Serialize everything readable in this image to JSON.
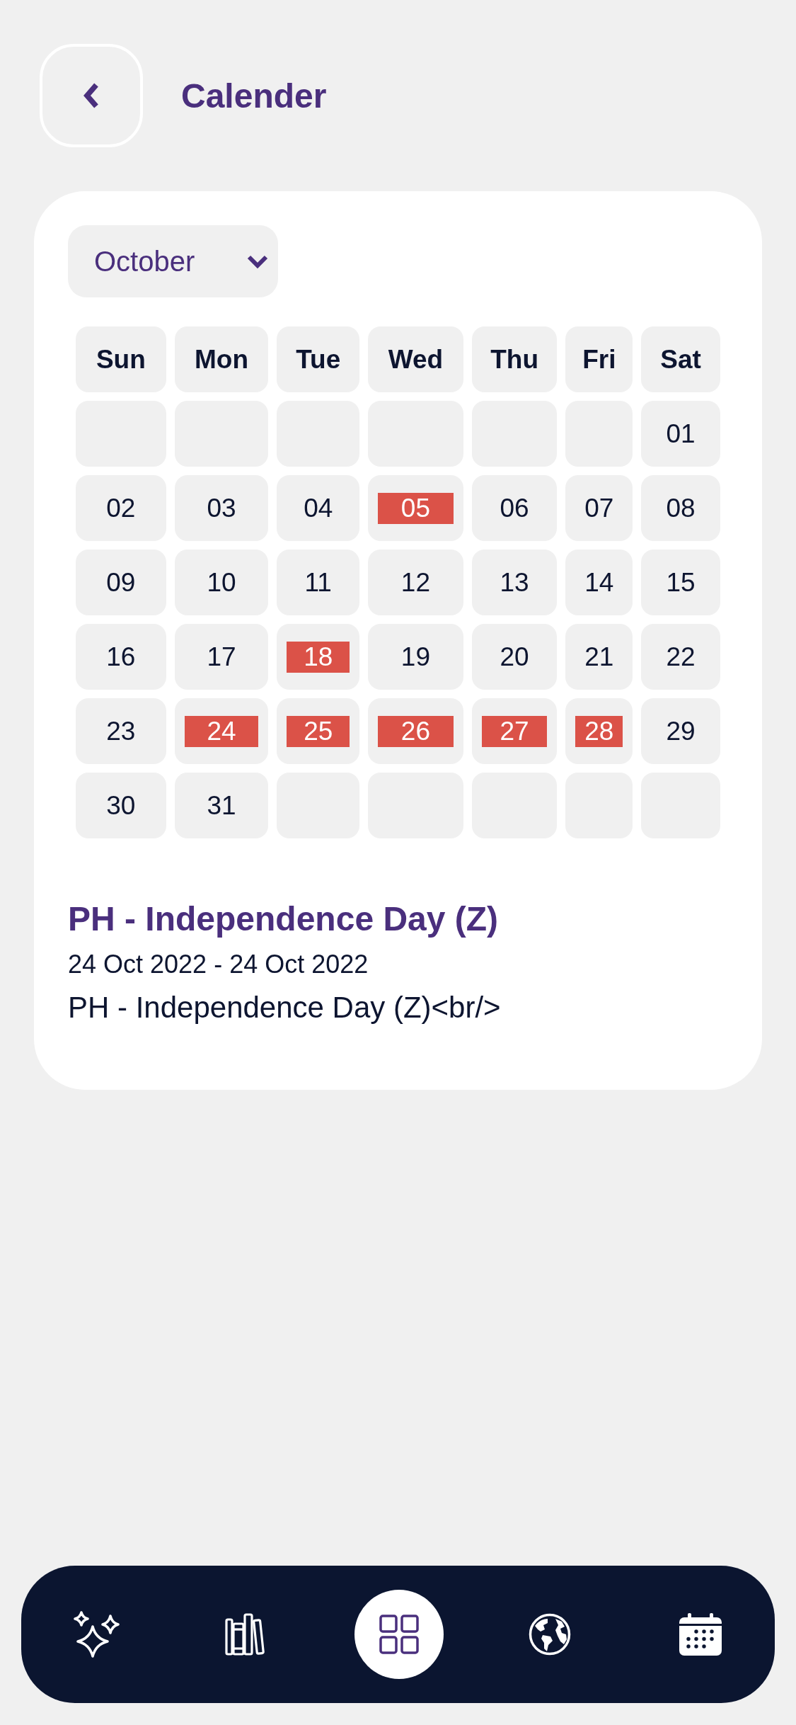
{
  "header": {
    "title": "Calender"
  },
  "month_select": {
    "value": "October"
  },
  "calendar": {
    "weekdays": [
      "Sun",
      "Mon",
      "Tue",
      "Wed",
      "Thu",
      "Fri",
      "Sat"
    ],
    "weeks": [
      [
        {
          "kind": "blank"
        },
        {
          "kind": "blank"
        },
        {
          "kind": "blank"
        },
        {
          "kind": "blank"
        },
        {
          "kind": "blank"
        },
        {
          "kind": "blank"
        },
        {
          "kind": "day",
          "day": "01",
          "has_event": false
        }
      ],
      [
        {
          "kind": "day",
          "day": "02",
          "has_event": false
        },
        {
          "kind": "day",
          "day": "03",
          "has_event": false
        },
        {
          "kind": "day",
          "day": "04",
          "has_event": false
        },
        {
          "kind": "day",
          "day": "05",
          "has_event": true
        },
        {
          "kind": "day",
          "day": "06",
          "has_event": false
        },
        {
          "kind": "day",
          "day": "07",
          "has_event": false
        },
        {
          "kind": "day",
          "day": "08",
          "has_event": false
        }
      ],
      [
        {
          "kind": "day",
          "day": "09",
          "has_event": false
        },
        {
          "kind": "day",
          "day": "10",
          "has_event": false
        },
        {
          "kind": "day",
          "day": "11",
          "has_event": false
        },
        {
          "kind": "day",
          "day": "12",
          "has_event": false
        },
        {
          "kind": "day",
          "day": "13",
          "has_event": false
        },
        {
          "kind": "day",
          "day": "14",
          "has_event": false
        },
        {
          "kind": "day",
          "day": "15",
          "has_event": false
        }
      ],
      [
        {
          "kind": "day",
          "day": "16",
          "has_event": false
        },
        {
          "kind": "day",
          "day": "17",
          "has_event": false
        },
        {
          "kind": "day",
          "day": "18",
          "has_event": true
        },
        {
          "kind": "day",
          "day": "19",
          "has_event": false
        },
        {
          "kind": "day",
          "day": "20",
          "has_event": false
        },
        {
          "kind": "day",
          "day": "21",
          "has_event": false
        },
        {
          "kind": "day",
          "day": "22",
          "has_event": false
        }
      ],
      [
        {
          "kind": "day",
          "day": "23",
          "has_event": false
        },
        {
          "kind": "day",
          "day": "24",
          "has_event": true
        },
        {
          "kind": "day",
          "day": "25",
          "has_event": true
        },
        {
          "kind": "day",
          "day": "26",
          "has_event": true
        },
        {
          "kind": "day",
          "day": "27",
          "has_event": true
        },
        {
          "kind": "day",
          "day": "28",
          "has_event": true
        },
        {
          "kind": "day",
          "day": "29",
          "has_event": false
        }
      ],
      [
        {
          "kind": "day",
          "day": "30",
          "has_event": false
        },
        {
          "kind": "day",
          "day": "31",
          "has_event": false
        },
        {
          "kind": "blank"
        },
        {
          "kind": "blank"
        },
        {
          "kind": "blank"
        },
        {
          "kind": "blank"
        },
        {
          "kind": "blank"
        }
      ]
    ]
  },
  "event": {
    "title": "PH - Independence Day (Z)",
    "dates": "24 Oct 2022 - 24 Oct 2022",
    "description": "PH - Independence Day (Z)<br/>"
  },
  "nav": {
    "items": [
      {
        "selected": false
      },
      {
        "selected": false
      },
      {
        "selected": true
      },
      {
        "selected": false
      },
      {
        "selected": false
      }
    ]
  }
}
